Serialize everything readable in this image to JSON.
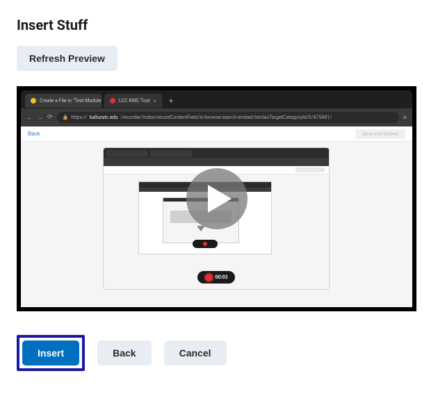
{
  "dialog": {
    "title": "Insert Stuff",
    "refresh_label": "Refresh Preview",
    "insert_label": "Insert",
    "back_label": "Back",
    "cancel_label": "Cancel"
  },
  "preview": {
    "browser": {
      "tabs": [
        {
          "label": "Create a File in \"Test Module\""
        },
        {
          "label": "LCC KMC Tool"
        }
      ],
      "url_prefix": "https://",
      "url_host": "kalturatc.edu",
      "url_path": "/recorder/index/recordContentField/in-browse-search-embed.htmlasTargetCategoryId/0/475441/",
      "inner_back_label": "Back",
      "inner_save_label": "Save and Embed",
      "rec_time": "00:03"
    }
  }
}
